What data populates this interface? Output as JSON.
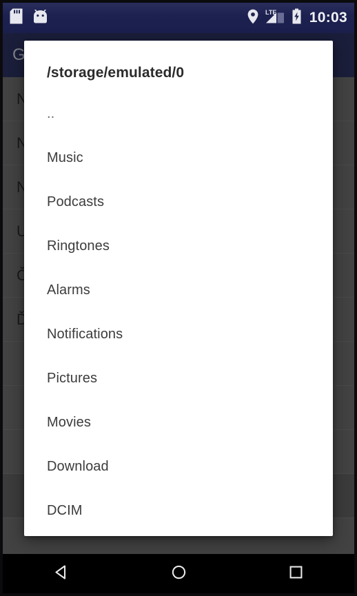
{
  "status_bar": {
    "icons_left": [
      {
        "name": "sd-card-icon",
        "label": "SD card"
      },
      {
        "name": "android-head-icon",
        "label": "Android"
      }
    ],
    "icons_right": [
      {
        "name": "location-pin-icon",
        "label": "Location"
      },
      {
        "name": "lte-signal-icon",
        "label": "LTE"
      },
      {
        "name": "battery-charging-icon",
        "label": "Battery charging"
      }
    ],
    "lte_label": "LTE",
    "clock": "10:03",
    "background_color": "#1f2350"
  },
  "app_bar": {
    "title": "G",
    "background_color": "#2e3362"
  },
  "background_list": {
    "rows": [
      {
        "label": "N",
        "highlighted": false
      },
      {
        "label": "N",
        "highlighted": false
      },
      {
        "label": "N",
        "highlighted": false
      },
      {
        "label": "U",
        "highlighted": false
      },
      {
        "label": "Č",
        "highlighted": false
      },
      {
        "label": "Ď",
        "highlighted": false
      },
      {
        "label": "",
        "highlighted": false
      },
      {
        "label": "",
        "highlighted": false
      },
      {
        "label": "",
        "highlighted": false
      },
      {
        "label": "",
        "highlighted": true
      },
      {
        "label": "",
        "highlighted": false
      }
    ]
  },
  "dialog": {
    "title": "/storage/emulated/0",
    "items": [
      {
        "label": ".."
      },
      {
        "label": "Music"
      },
      {
        "label": "Podcasts"
      },
      {
        "label": "Ringtones"
      },
      {
        "label": "Alarms"
      },
      {
        "label": "Notifications"
      },
      {
        "label": "Pictures"
      },
      {
        "label": "Movies"
      },
      {
        "label": "Download"
      },
      {
        "label": "DCIM"
      }
    ],
    "background_color": "#ffffff"
  },
  "nav_bar": {
    "buttons": [
      {
        "name": "back-button",
        "label": "Back"
      },
      {
        "name": "home-button",
        "label": "Home"
      },
      {
        "name": "recents-button",
        "label": "Recents"
      }
    ],
    "background_color": "#000000"
  }
}
